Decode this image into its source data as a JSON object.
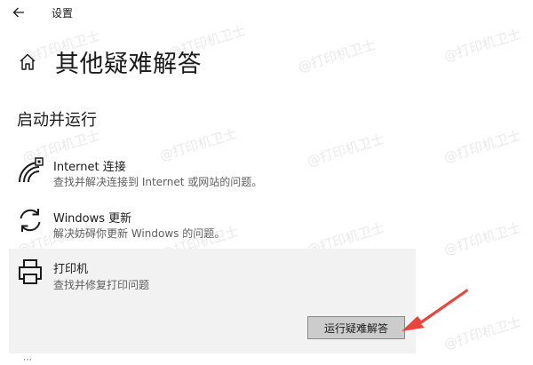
{
  "window": {
    "title": "设置"
  },
  "page": {
    "title": "其他疑难解答"
  },
  "section": {
    "title": "启动并运行"
  },
  "items": [
    {
      "label": "Internet 连接",
      "description": "查找并解决连接到 Internet 或网站的问题。",
      "icon": "wifi-icon"
    },
    {
      "label": "Windows 更新",
      "description": "解决妨碍你更新 Windows 的问题。",
      "icon": "refresh-icon"
    },
    {
      "label": "打印机",
      "description": "查找并修复打印问题",
      "icon": "printer-icon",
      "selected": true
    }
  ],
  "run_button": {
    "label": "运行疑难解答"
  },
  "watermark": {
    "text": "@打印机卫士"
  },
  "annotation": {
    "arrow_color": "#e8463c"
  },
  "colors": {
    "selected_bg": "#f2f2f2",
    "button_bg": "#cccccc"
  }
}
